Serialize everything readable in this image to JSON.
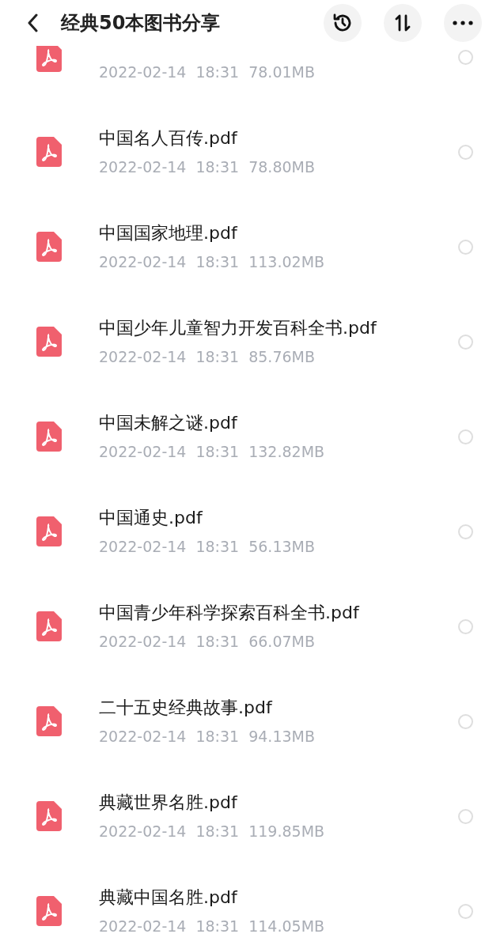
{
  "header": {
    "title": "经典50本图书分享"
  },
  "files": [
    {
      "date": "2022-02-14",
      "time": "18:31",
      "size": "78.01MB",
      "selected": false
    },
    {
      "name": "中国名人百传.pdf",
      "date": "2022-02-14",
      "time": "18:31",
      "size": "78.80MB",
      "selected": false
    },
    {
      "name": "中国国家地理.pdf",
      "date": "2022-02-14",
      "time": "18:31",
      "size": "113.02MB",
      "selected": false
    },
    {
      "name": "中国少年儿童智力开发百科全书.pdf",
      "date": "2022-02-14",
      "time": "18:31",
      "size": "85.76MB",
      "selected": false
    },
    {
      "name": "中国未解之谜.pdf",
      "date": "2022-02-14",
      "time": "18:31",
      "size": "132.82MB",
      "selected": false
    },
    {
      "name": "中国通史.pdf",
      "date": "2022-02-14",
      "time": "18:31",
      "size": "56.13MB",
      "selected": false
    },
    {
      "name": "中国青少年科学探索百科全书.pdf",
      "date": "2022-02-14",
      "time": "18:31",
      "size": "66.07MB",
      "selected": false
    },
    {
      "name": "二十五史经典故事.pdf",
      "date": "2022-02-14",
      "time": "18:31",
      "size": "94.13MB",
      "selected": false
    },
    {
      "name": "典藏世界名胜.pdf",
      "date": "2022-02-14",
      "time": "18:31",
      "size": "119.85MB",
      "selected": false
    },
    {
      "name": "典藏中国名胜.pdf",
      "date": "2022-02-14",
      "time": "18:31",
      "size": "114.05MB",
      "selected": false
    }
  ]
}
